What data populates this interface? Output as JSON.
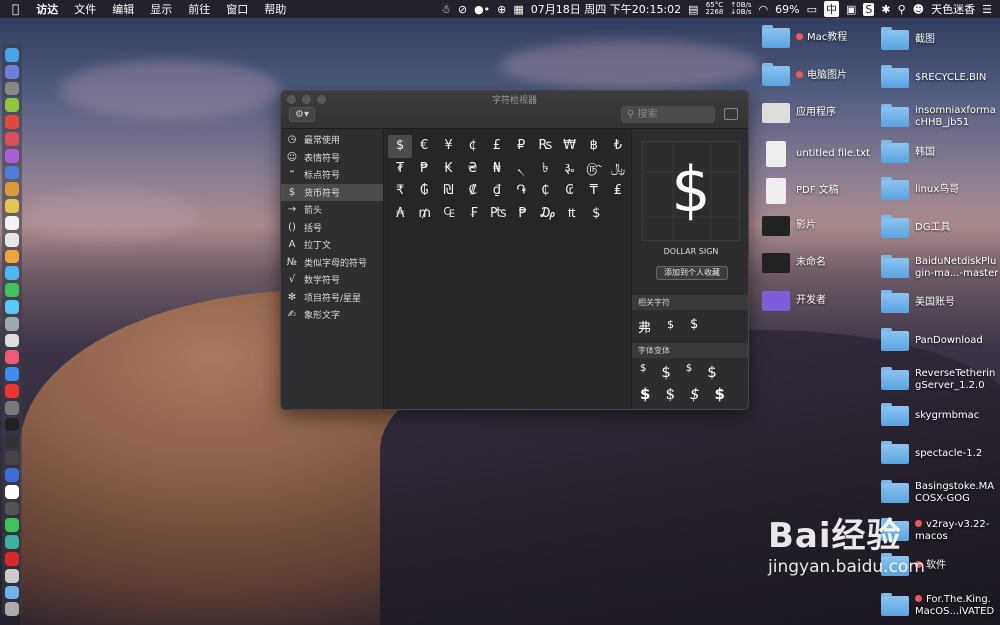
{
  "menubar": {
    "app_name": "访达",
    "menus": [
      "文件",
      "编辑",
      "显示",
      "前往",
      "窗口",
      "帮助"
    ],
    "datetime": "07月18日 周四 下午20:15:02",
    "cpu_temp": "65°C",
    "fan_rpm": "2268",
    "net_up": "↑0B/s",
    "net_down": "↓0B/s",
    "battery": "69%",
    "input_method": "中",
    "user_name": "天色迷香"
  },
  "window": {
    "title": "字符检视器",
    "search_placeholder": "搜索",
    "categories": [
      {
        "icon": "◷",
        "label": "最常使用"
      },
      {
        "icon": "☺",
        "label": "表情符号"
      },
      {
        "icon": "“",
        "label": "标点符号"
      },
      {
        "icon": "$",
        "label": "货币符号"
      },
      {
        "icon": "→",
        "label": "箭头"
      },
      {
        "icon": "()",
        "label": "括号"
      },
      {
        "icon": "A",
        "label": "拉丁文"
      },
      {
        "icon": "№",
        "label": "类似字母的符号"
      },
      {
        "icon": "√",
        "label": "数学符号"
      },
      {
        "icon": "✻",
        "label": "项目符号/星星"
      },
      {
        "icon": "✍",
        "label": "象形文字"
      }
    ],
    "selected_category": "货币符号",
    "grid_rows": [
      [
        "$",
        "€",
        "¥",
        "¢",
        "£",
        "₽",
        "₨",
        "₩",
        "฿",
        "₺"
      ],
      [
        "₮",
        "₱",
        "₭",
        "₴",
        "₦",
        "৲",
        "৳",
        "૱",
        "௹",
        "﷼"
      ],
      [
        "₹",
        "₲",
        "₪",
        "₡",
        "₫",
        "֏",
        "₵",
        "₢",
        "₸",
        "₤"
      ],
      [
        "₳",
        "₥",
        "₠",
        "₣",
        "₧",
        "₱",
        "₯",
        "₶",
        "$"
      ]
    ],
    "detail": {
      "glyph": "$",
      "name": "DOLLAR SIGN",
      "add_favorite": "添加到个人收藏",
      "related_header": "相关字符",
      "related": [
        "弗",
        "$",
        "$"
      ],
      "variants_header": "字体变体",
      "variants_row1": [
        "$",
        "$",
        "$",
        "$"
      ],
      "variants_row2": [
        "$",
        "$",
        "$",
        "$"
      ]
    }
  },
  "desktop": {
    "col1": [
      {
        "label": "Mac教程",
        "type": "folder",
        "tag": true
      },
      {
        "label": "电脑图片",
        "type": "folder",
        "tag": true
      },
      {
        "label": "应用程序",
        "type": "disk",
        "tag": false
      },
      {
        "label": "untitled file.txt",
        "type": "file",
        "tag": false
      },
      {
        "label": "PDF 文稿",
        "type": "file",
        "tag": false
      },
      {
        "label": "影片",
        "type": "image",
        "tag": false
      },
      {
        "label": "未命名",
        "type": "image",
        "tag": false
      },
      {
        "label": "开发者",
        "type": "app",
        "tag": false
      }
    ],
    "col2": [
      {
        "label": "截图",
        "tag": false
      },
      {
        "label": "$RECYCLE.BIN",
        "tag": false
      },
      {
        "label": "insomniaxforma\ncHHB_jb51",
        "tag": false
      },
      {
        "label": "韩国",
        "tag": false
      },
      {
        "label": "linux鸟哥",
        "tag": false
      },
      {
        "label": "DG工具",
        "tag": false
      },
      {
        "label": "BaiduNetdiskPlu\ngin-ma...-master",
        "tag": false
      },
      {
        "label": "美国账号",
        "tag": false
      },
      {
        "label": "PanDownload",
        "tag": false
      },
      {
        "label": "ReverseTetherin\ngServer_1.2.0",
        "tag": false
      },
      {
        "label": "skygrmbmac",
        "tag": false
      },
      {
        "label": "spectacle-1.2",
        "tag": false
      },
      {
        "label": "Basingstoke.MA\nCOSX-GOG",
        "tag": false
      },
      {
        "label": "v2ray-v3.22-\nmacos",
        "tag": true
      },
      {
        "label": "软件",
        "tag": true
      },
      {
        "label": "For.The.King.\nMacOS...iVATED",
        "tag": true
      }
    ]
  },
  "watermark": {
    "brand": "Bai经验",
    "url": "jingyan.baidu.com"
  }
}
